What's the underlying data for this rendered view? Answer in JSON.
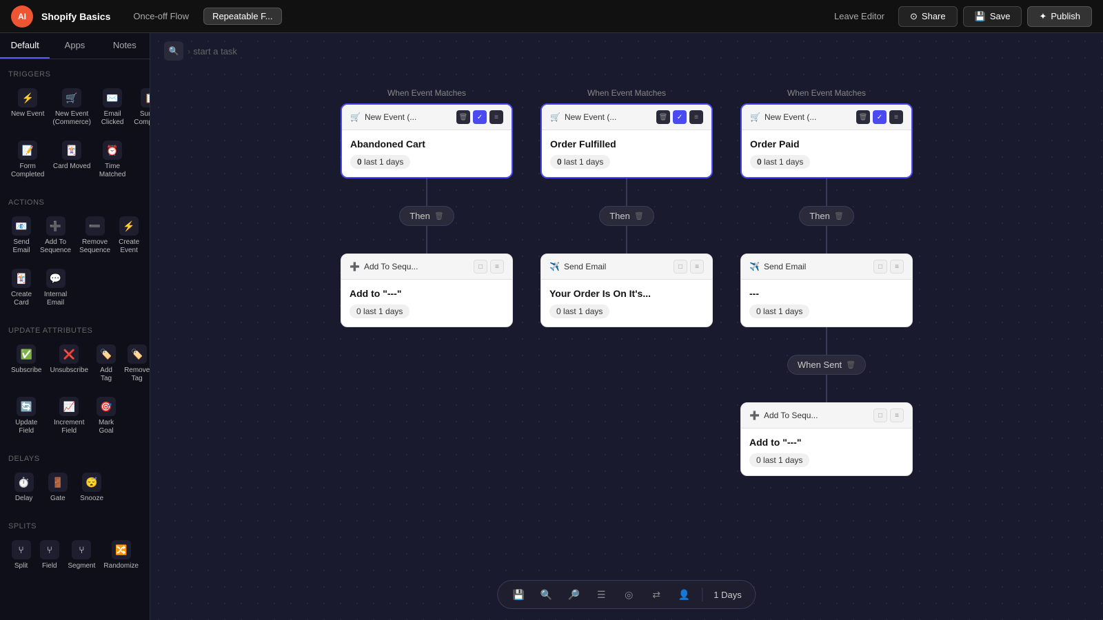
{
  "header": {
    "logo": "AI",
    "title": "Shopify Basics",
    "tabs": [
      {
        "label": "Once-off Flow",
        "active": false
      },
      {
        "label": "Repeatable F...",
        "active": true
      }
    ],
    "leave_editor": "Leave Editor",
    "share": "Share",
    "save": "Save",
    "publish": "Publish"
  },
  "sidebar": {
    "tabs": [
      "Default",
      "Apps",
      "Notes"
    ],
    "active_tab": "Default",
    "sections": [
      {
        "title": "Triggers",
        "items": [
          {
            "icon": "⚡",
            "label": "New Event"
          },
          {
            "icon": "🛒",
            "label": "New Event (Commerce)"
          },
          {
            "icon": "✉️",
            "label": "Email Clicked"
          },
          {
            "icon": "📋",
            "label": "Survey Completed"
          },
          {
            "icon": "📝",
            "label": "Form Completed"
          },
          {
            "icon": "🃏",
            "label": "Card Moved"
          },
          {
            "icon": "⏰",
            "label": "Time Matched"
          }
        ]
      },
      {
        "title": "Actions",
        "items": [
          {
            "icon": "📧",
            "label": "Send Email"
          },
          {
            "icon": "➕",
            "label": "Add To Sequence"
          },
          {
            "icon": "➖",
            "label": "Remove Sequence"
          },
          {
            "icon": "⚡",
            "label": "Create Event"
          },
          {
            "icon": "🃏",
            "label": "Create Card"
          },
          {
            "icon": "💬",
            "label": "Internal Email"
          }
        ]
      },
      {
        "title": "Update Attributes",
        "items": [
          {
            "icon": "✅",
            "label": "Subscribe"
          },
          {
            "icon": "❌",
            "label": "Unsubscribe"
          },
          {
            "icon": "🏷️",
            "label": "Add Tag"
          },
          {
            "icon": "🏷️",
            "label": "Remove Tag"
          },
          {
            "icon": "🔄",
            "label": "Update Field"
          },
          {
            "icon": "📈",
            "label": "Increment Field"
          },
          {
            "icon": "🎯",
            "label": "Mark Goal"
          }
        ]
      },
      {
        "title": "Delays",
        "items": [
          {
            "icon": "⏱️",
            "label": "Delay"
          },
          {
            "icon": "🚪",
            "label": "Gate"
          },
          {
            "icon": "😴",
            "label": "Snooze"
          }
        ]
      },
      {
        "title": "Splits",
        "items": [
          {
            "icon": "⑂",
            "label": "Split"
          },
          {
            "icon": "⑂",
            "label": "Field"
          },
          {
            "icon": "⑂",
            "label": "Segment"
          },
          {
            "icon": "🔀",
            "label": "Randomize"
          }
        ]
      }
    ]
  },
  "canvas": {
    "breadcrumb": "start a task",
    "columns": [
      {
        "event_header": "When Event Matches",
        "trigger": {
          "title": "New Event (...",
          "name": "Abandoned Cart",
          "stat": "0 last 1 days"
        },
        "then_label": "Then",
        "action": {
          "title": "Add To Sequ...",
          "name": "Add to \"---\"",
          "stat": "0 last 1 days"
        }
      },
      {
        "event_header": "When Event Matches",
        "trigger": {
          "title": "New Event (...",
          "name": "Order Fulfilled",
          "stat": "0 last 1 days"
        },
        "then_label": "Then",
        "action": {
          "title": "Send Email",
          "name": "Your Order Is On It's...",
          "stat": "0 last 1 days"
        }
      },
      {
        "event_header": "When Event Matches",
        "trigger": {
          "title": "New Event (...",
          "name": "Order Paid",
          "stat": "0 last 1 days"
        },
        "then_label": "Then",
        "action": {
          "title": "Send Email",
          "name": "---",
          "stat": "0 last 1 days",
          "has_sub_action": true,
          "sub_connector": "When Sent",
          "sub_action": {
            "title": "Add To Sequ...",
            "name": "Add to \"---\"",
            "stat": "0 last 1 days"
          }
        }
      }
    ]
  },
  "bottom_toolbar": {
    "days_label": "1 Days"
  }
}
